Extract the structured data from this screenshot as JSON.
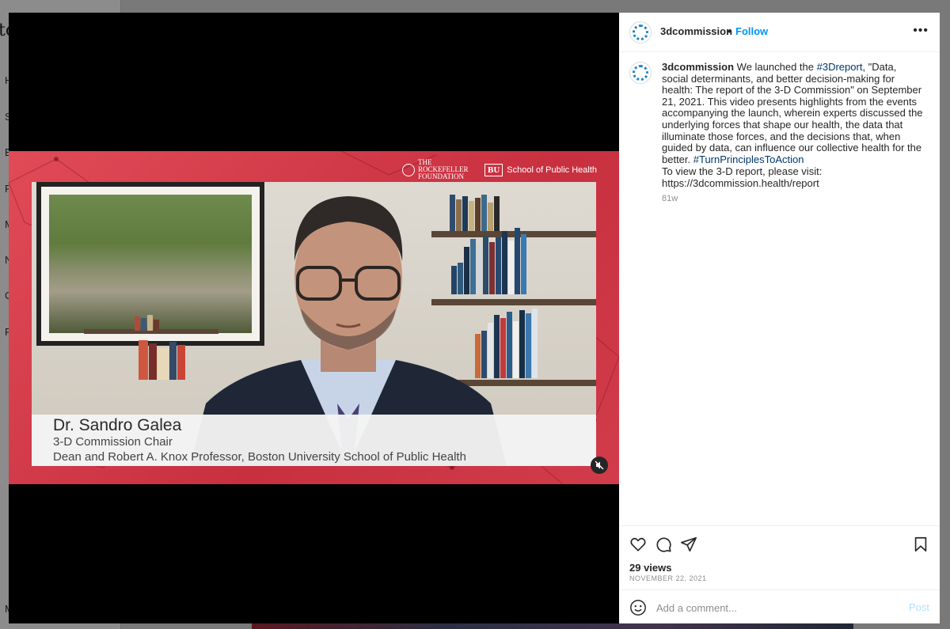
{
  "background": {
    "logo_fragment": "to",
    "nav_letters": [
      "H",
      "S",
      "E",
      "R",
      "M",
      "N",
      "C",
      "P",
      "M"
    ]
  },
  "sponsors": {
    "rockefeller": "THE ROCKEFELLER FOUNDATION",
    "bu_badge": "BU",
    "bu_label": "School of Public Health"
  },
  "video": {
    "lower_third_name": "Dr. Sandro Galea",
    "lower_third_role": "3-D Commission Chair",
    "lower_third_title": "Dean and Robert A. Knox Professor, Boston University School of Public Health",
    "muted": true
  },
  "post": {
    "username": "3dcommission",
    "dot": "•",
    "follow_label": "Follow",
    "more_label": "•••",
    "caption_user": "3dcommission",
    "caption_part1": "We launched the",
    "hashtag1": "#3Dreport",
    "caption_part2": ", \"Data, social determinants, and better decision-making for health: The report of the 3-D Commission\" on September 21, 2021. This video presents highlights from the events accompanying the launch, wherein experts discussed the underlying forces that shape our health, the data that illuminate those forces, and the decisions that, when guided by data, can influence our collective health for the better.",
    "hashtag2": "#TurnPrinciplesToAction",
    "caption_link_line1": "To view the 3-D report, please visit:",
    "caption_link_line2": "https://3dcommission.health/report",
    "age": "81w",
    "views": "29 views",
    "date": "NOVEMBER 22, 2021",
    "comment_placeholder": "Add a comment...",
    "post_label": "Post"
  },
  "colors": {
    "accent": "#0095f6",
    "hashtag": "#00376b",
    "video_frame": "#d83a4a"
  }
}
